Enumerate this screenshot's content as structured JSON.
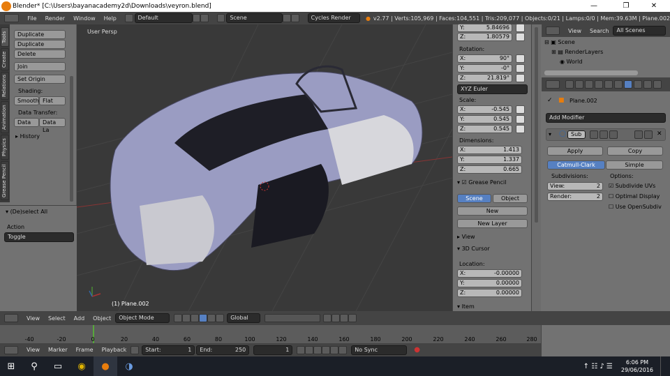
{
  "window": {
    "title": "Blender* [C:\\Users\\bayanacademy2d\\Downloads\\veyron.blend]"
  },
  "infobar": {
    "menus": [
      "File",
      "Render",
      "Window",
      "Help"
    ],
    "layout": "Default",
    "scene": "Scene",
    "engine": "Cycles Render",
    "stats": "v2.77 | Verts:105,969 | Faces:104,551 | Tris:209,077 | Objects:0/21 | Lamps:0/0 | Mem:39.63M | Plane.002"
  },
  "tool_tabs": [
    "Tools",
    "Create",
    "Relations",
    "Animation",
    "Physics",
    "Grease Pencil"
  ],
  "tools": {
    "duplicate": "Duplicate",
    "duplicate_linked": "Duplicate Linked",
    "delete": "Delete",
    "join": "Join",
    "set_origin": "Set Origin",
    "shading_label": "Shading:",
    "smooth": "Smooth",
    "flat": "Flat",
    "data_transfer_label": "Data Transfer:",
    "data": "Data",
    "data_la": "Data La",
    "history": "History"
  },
  "operator": {
    "title": "(De)select All",
    "action_label": "Action",
    "action_value": "Toggle"
  },
  "viewport": {
    "label": "User Persp",
    "object_label": "(1) Plane.002"
  },
  "npanel": {
    "loc_y": {
      "axis": "Y:",
      "value": "5.84696"
    },
    "loc_z": {
      "axis": "Z:",
      "value": "1.80579"
    },
    "rotation_label": "Rotation:",
    "rot_x": {
      "axis": "X:",
      "value": "90°"
    },
    "rot_y": {
      "axis": "Y:",
      "value": "-0°"
    },
    "rot_z": {
      "axis": "Z:",
      "value": "21.819°"
    },
    "rot_mode": "XYZ Euler",
    "scale_label": "Scale:",
    "scale_x": {
      "axis": "X:",
      "value": "-0.545"
    },
    "scale_y": {
      "axis": "Y:",
      "value": "0.545"
    },
    "scale_z": {
      "axis": "Z:",
      "value": "0.545"
    },
    "dimensions_label": "Dimensions:",
    "dim_x": {
      "axis": "X:",
      "value": "1.413"
    },
    "dim_y": {
      "axis": "Y:",
      "value": "1.337"
    },
    "dim_z": {
      "axis": "Z:",
      "value": "0.665"
    },
    "grease_pencil": "Grease Pencil",
    "gp_scene": "Scene",
    "gp_object": "Object",
    "gp_new": "New",
    "new_layer": "New Layer",
    "view": "View",
    "cursor": "3D Cursor",
    "location_label": "Location:",
    "cur_x": {
      "axis": "X:",
      "value": "-0.00000"
    },
    "cur_y": {
      "axis": "Y:",
      "value": "0.00000"
    },
    "cur_z": {
      "axis": "Z:",
      "value": "0.00000"
    },
    "item": "Item"
  },
  "outliner": {
    "view": "View",
    "search": "Search",
    "filter": "All Scenes",
    "rows": [
      "Scene",
      "RenderLayers",
      "World"
    ]
  },
  "properties": {
    "object_name": "Plane.002",
    "add_modifier": "Add Modifier",
    "mod_name": "Sub",
    "apply": "Apply",
    "copy": "Copy",
    "catmull": "Catmull-Clark",
    "simple": "Simple",
    "subdivisions_label": "Subdivisions:",
    "options_label": "Options:",
    "view_label": "View:",
    "view_value": "2",
    "render_label": "Render:",
    "render_value": "2",
    "subdivide_uvs": "Subdivide UVs",
    "optimal_display": "Optimal Display",
    "use_opensubdiv": "Use OpenSubdiv"
  },
  "viewheader": {
    "menus": [
      "View",
      "Select",
      "Add",
      "Object"
    ],
    "mode": "Object Mode",
    "orientation": "Global"
  },
  "timeline": {
    "ticks": [
      "-40",
      "-20",
      "0",
      "20",
      "40",
      "60",
      "80",
      "100",
      "120",
      "140",
      "160",
      "180",
      "200",
      "220",
      "240",
      "260",
      "280"
    ],
    "menus": [
      "View",
      "Marker",
      "Frame",
      "Playback"
    ],
    "start": "Start:",
    "start_value": "1",
    "end": "End:",
    "end_value": "250",
    "current": "1",
    "sync": "No Sync"
  },
  "taskbar": {
    "time": "6:06 PM",
    "date": "29/06/2016"
  },
  "colors": {
    "accent": "#5680c2",
    "viewport": "#393939",
    "panel": "#727272",
    "header": "#444444"
  }
}
